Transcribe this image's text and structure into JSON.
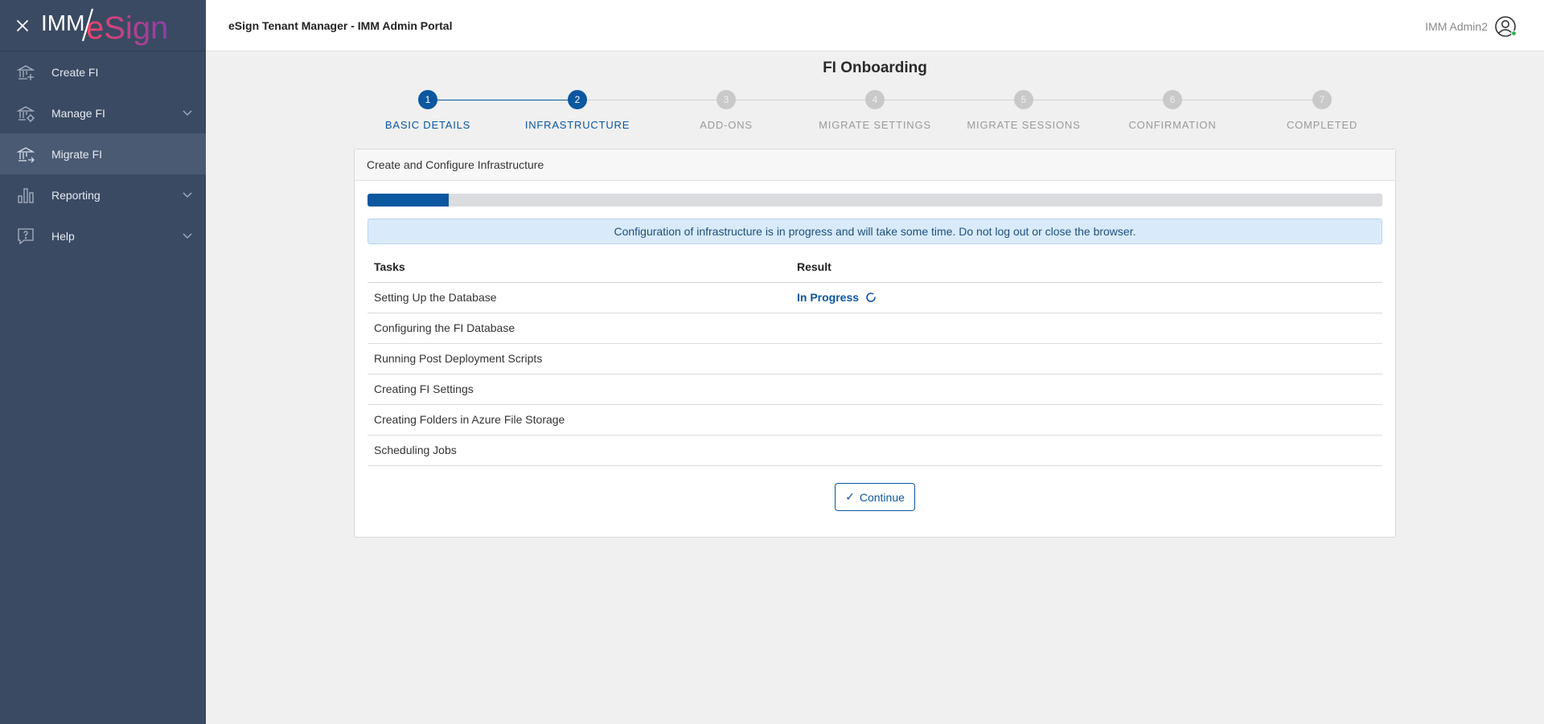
{
  "sidebar": {
    "logo_imm": "IMM",
    "logo_esign": "eSign",
    "items": [
      {
        "label": "Create FI",
        "icon": "bank-plus-icon",
        "expandable": false
      },
      {
        "label": "Manage FI",
        "icon": "bank-settings-icon",
        "expandable": true
      },
      {
        "label": "Migrate FI",
        "icon": "bank-migrate-icon",
        "expandable": false,
        "active": true
      },
      {
        "label": "Reporting",
        "icon": "bar-chart-icon",
        "expandable": true
      },
      {
        "label": "Help",
        "icon": "help-icon",
        "expandable": true
      }
    ]
  },
  "header": {
    "title": "eSign Tenant Manager - IMM Admin Portal",
    "user_name": "IMM Admin2"
  },
  "page": {
    "title": "FI Onboarding"
  },
  "stepper": {
    "current_step": 2,
    "steps": [
      {
        "number": "1",
        "label": "BASIC DETAILS",
        "state": "done"
      },
      {
        "number": "2",
        "label": "INFRASTRUCTURE",
        "state": "done"
      },
      {
        "number": "3",
        "label": "ADD-ONS",
        "state": "todo"
      },
      {
        "number": "4",
        "label": "MIGRATE SETTINGS",
        "state": "todo"
      },
      {
        "number": "5",
        "label": "MIGRATE SESSIONS",
        "state": "todo"
      },
      {
        "number": "6",
        "label": "CONFIRMATION",
        "state": "todo"
      },
      {
        "number": "7",
        "label": "COMPLETED",
        "state": "todo"
      }
    ]
  },
  "card": {
    "title": "Create and Configure Infrastructure",
    "progress_percent": 8,
    "alert": "Configuration of infrastructure is in progress and will take some time. Do not log out or close the browser.",
    "table": {
      "headers": [
        "Tasks",
        "Result"
      ],
      "rows": [
        {
          "task": "Setting Up the Database",
          "result": "In Progress"
        },
        {
          "task": "Configuring the FI Database",
          "result": ""
        },
        {
          "task": "Running Post Deployment Scripts",
          "result": ""
        },
        {
          "task": "Creating FI Settings",
          "result": ""
        },
        {
          "task": "Creating Folders in Azure File Storage",
          "result": ""
        },
        {
          "task": "Scheduling Jobs",
          "result": ""
        }
      ]
    },
    "continue_label": "Continue"
  },
  "colors": {
    "primary": "#0b57a0",
    "sidebar_bg": "#3a4a62",
    "logo_pink": "#e6356f",
    "logo_purple": "#8a3fa8"
  }
}
